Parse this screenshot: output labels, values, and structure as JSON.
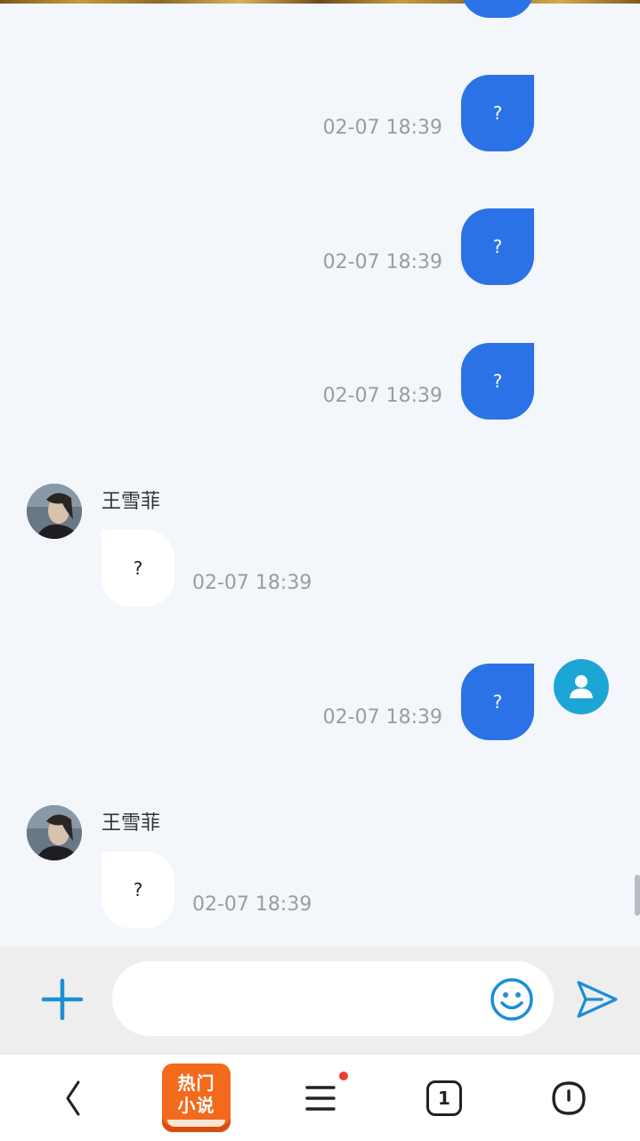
{
  "messages": [
    {
      "direction": "out",
      "text": "?",
      "time": "02-07 18:39"
    },
    {
      "direction": "out",
      "text": "?",
      "time": "02-07 18:39"
    },
    {
      "direction": "out",
      "text": "?",
      "time": "02-07 18:39"
    },
    {
      "direction": "in",
      "sender": "王雪菲",
      "text": "?",
      "time": "02-07 18:39"
    },
    {
      "direction": "out",
      "text": "?",
      "time": "02-07 18:39"
    },
    {
      "direction": "in",
      "sender": "王雪菲",
      "text": "?",
      "time": "02-07 18:39"
    }
  ],
  "composer": {
    "input_value": "",
    "icons": {
      "add": "plus-icon",
      "emoji": "smiley-icon",
      "send": "send-icon"
    },
    "accent_color": "#1a8fd6"
  },
  "bottom_nav": {
    "novel_badge_line1": "热门",
    "novel_badge_line2": "小说",
    "tab_count": "1",
    "icons": {
      "back": "chevron-left-icon",
      "menu": "menu-icon",
      "tabs": "tabs-icon",
      "home": "home-icon"
    }
  },
  "colors": {
    "outgoing_bubble": "#2b72e6",
    "incoming_bubble": "#ffffff",
    "background": "#f3f6fa",
    "notification_dot": "#ef3b32"
  }
}
